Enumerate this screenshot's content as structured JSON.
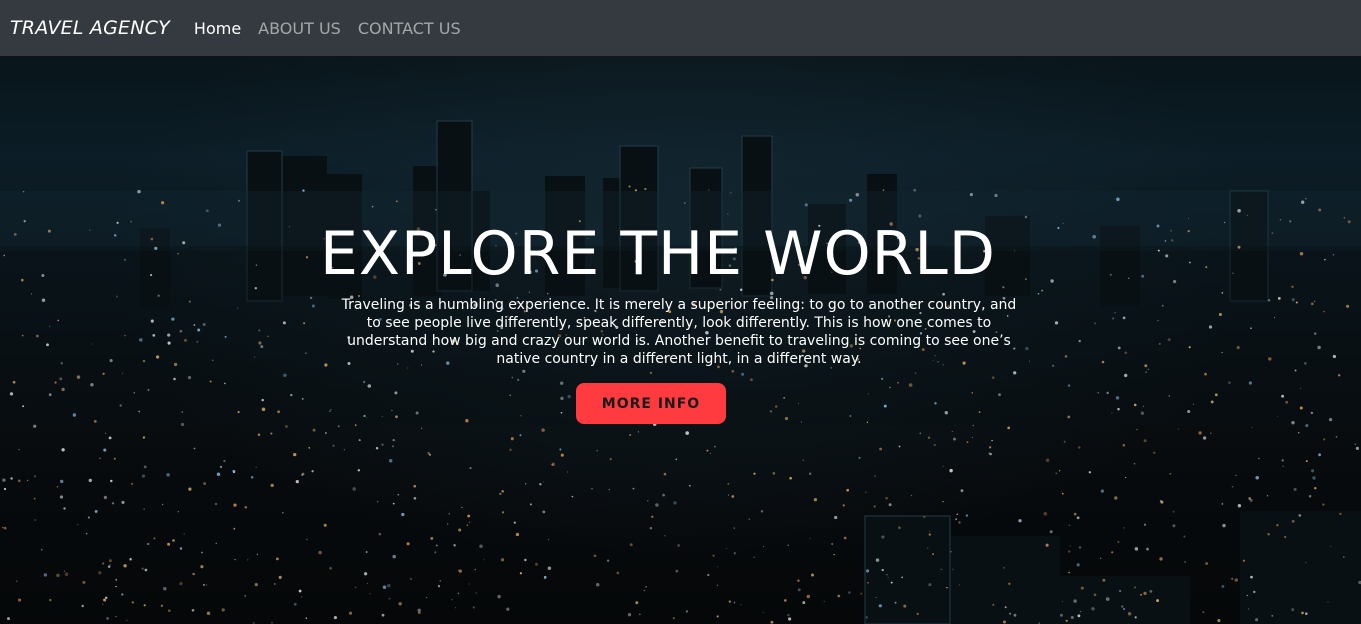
{
  "navbar": {
    "brand": "TRAVEL AGENCY",
    "links": [
      {
        "label": "Home",
        "active": true
      },
      {
        "label": "ABOUT US",
        "active": false
      },
      {
        "label": "CONTACT US",
        "active": false
      }
    ]
  },
  "hero": {
    "title": "EXPLORE THE WORLD",
    "text": "Traveling is a humbling experience. It is merely a superior feeling: to go to another country, and to see people live differently, speak differently, look differently. This is how one comes to understand how big and crazy our world is. Another benefit to traveling is coming to see one’s native country in a different light, in a different way.",
    "button_label": "MORE INFO"
  },
  "colors": {
    "navbar_bg": "#343a40",
    "button_bg": "#ff3b3f",
    "text": "#ffffff"
  }
}
